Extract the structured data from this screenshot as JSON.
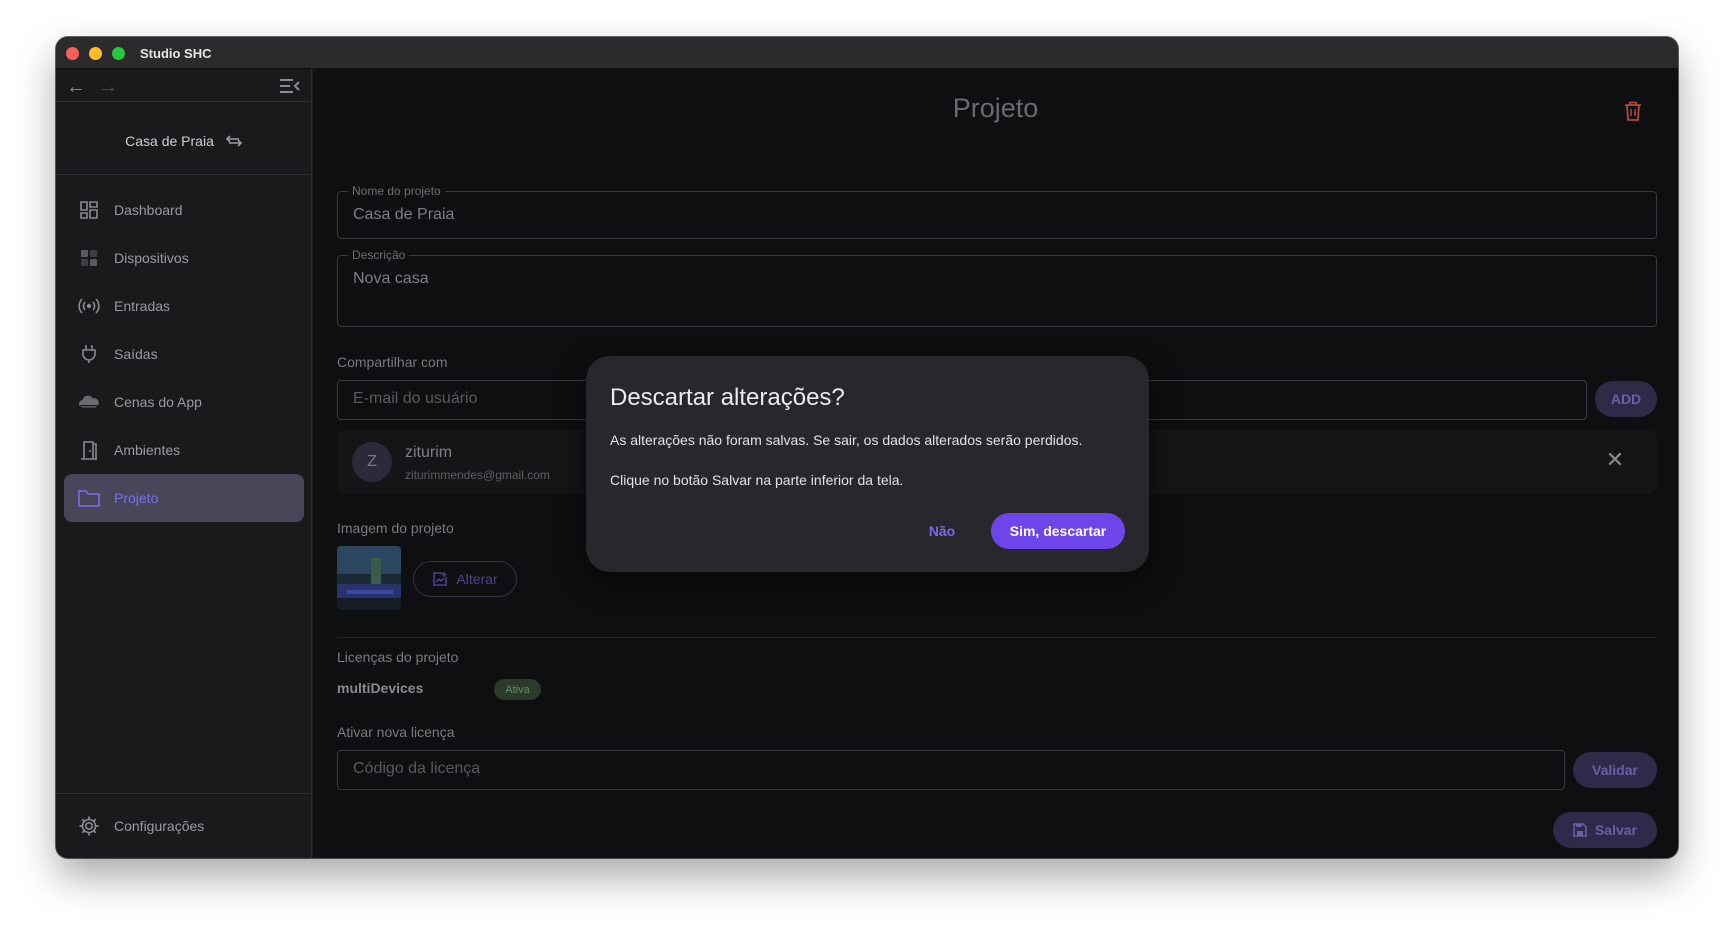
{
  "window": {
    "title": "Studio SHC"
  },
  "sidebar": {
    "project_name": "Casa de Praia",
    "items": [
      {
        "label": "Dashboard",
        "icon": "dashboard-icon"
      },
      {
        "label": "Dispositivos",
        "icon": "devices-icon"
      },
      {
        "label": "Entradas",
        "icon": "broadcast-icon"
      },
      {
        "label": "Saídas",
        "icon": "plug-icon"
      },
      {
        "label": "Cenas do App",
        "icon": "cloud-icon"
      },
      {
        "label": "Ambientes",
        "icon": "door-icon"
      },
      {
        "label": "Projeto",
        "icon": "folder-icon",
        "active": true
      }
    ],
    "settings_label": "Configurações"
  },
  "main": {
    "title": "Projeto",
    "name_field": {
      "label": "Nome do projeto",
      "value": "Casa de Praia"
    },
    "description_field": {
      "label": "Descrição",
      "value": "Nova casa"
    },
    "share": {
      "label": "Compartilhar com",
      "email_placeholder": "E-mail do usuário",
      "add_label": "ADD",
      "user": {
        "initial": "Z",
        "name": "ziturim",
        "email": "ziturimmendes@gmail.com"
      }
    },
    "image": {
      "label": "Imagem do projeto",
      "change_label": "Alterar"
    },
    "licenses": {
      "label": "Licenças do projeto",
      "items": [
        {
          "name": "multiDevices",
          "status": "Ativa"
        }
      ],
      "activate_label": "Ativar nova licença",
      "code_placeholder": "Código da licença",
      "validate_label": "Validar"
    },
    "save_label": "Salvar"
  },
  "dialog": {
    "title": "Descartar alterações?",
    "line1": "As alterações não foram salvas. Se sair, os dados alterados serão perdidos.",
    "line2": "Clique no botão Salvar na parte inferior da tela.",
    "no_label": "Não",
    "yes_label": "Sim, descartar"
  },
  "colors": {
    "accent": "#6e45e8",
    "accent_text": "#7b68ee",
    "background": "#0f0f11",
    "sidebar": "#1a1a1d",
    "dialog": "#28272c",
    "active_nav": "#4a4659",
    "delete": "#b5473d"
  }
}
